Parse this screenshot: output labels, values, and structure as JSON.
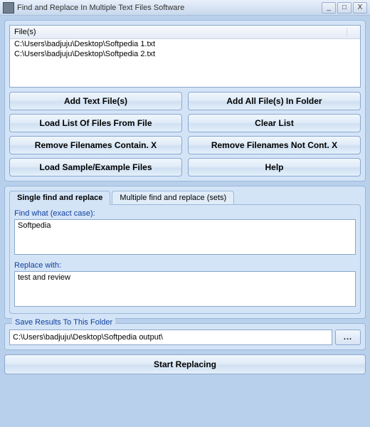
{
  "window": {
    "title": "Find and Replace In Multiple Text Files Software",
    "minimize": "_",
    "maximize": "□",
    "close": "X"
  },
  "file_list": {
    "header": "File(s)",
    "rows": [
      "C:\\Users\\badjuju\\Desktop\\Softpedia 1.txt",
      "C:\\Users\\badjuju\\Desktop\\Softpedia 2.txt"
    ]
  },
  "buttons": {
    "add_files": "Add Text File(s)",
    "add_folder": "Add All File(s) In Folder",
    "load_list": "Load List Of Files From File",
    "clear_list": "Clear List",
    "remove_contain": "Remove Filenames Contain. X",
    "remove_not_contain": "Remove Filenames Not Cont. X",
    "load_sample": "Load Sample/Example Files",
    "help": "Help"
  },
  "tabs": {
    "single": "Single find and replace",
    "multiple": "Multiple find and replace (sets)"
  },
  "find_replace": {
    "find_label": "Find what (exact case):",
    "find_value": "Softpedia",
    "replace_label": "Replace with:",
    "replace_value": "test and review"
  },
  "save": {
    "legend": "Save Results To This Folder",
    "path": "C:\\Users\\badjuju\\Desktop\\Softpedia output\\",
    "browse": "..."
  },
  "start": "Start Replacing"
}
